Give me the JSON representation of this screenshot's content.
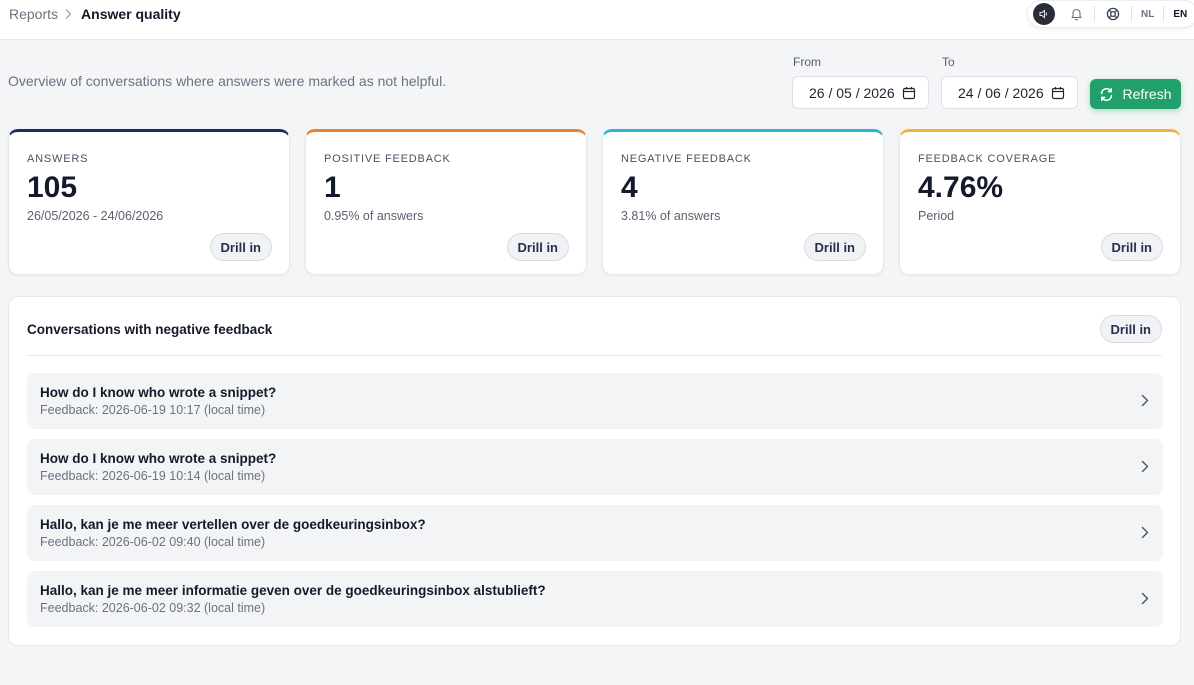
{
  "breadcrumb": {
    "root": "Reports",
    "current": "Answer quality"
  },
  "topbar": {
    "lang_nl": "NL",
    "lang_en": "EN",
    "active_lang": "EN"
  },
  "header": {
    "subtitle": "Overview of conversations where answers were marked as not helpful.",
    "from_label": "From",
    "from_value": "26 / 05 / 2026",
    "to_label": "To",
    "to_value": "24 / 06 / 2026",
    "refresh_label": "Refresh"
  },
  "cards": [
    {
      "title": "Answers",
      "value": "105",
      "sub": "26/05/2026 - 24/06/2026",
      "drill": "Drill in",
      "accent": "#1f2d5c"
    },
    {
      "title": "Positive feedback",
      "value": "1",
      "sub": "0.95% of answers",
      "drill": "Drill in",
      "accent": "#e8842f"
    },
    {
      "title": "Negative feedback",
      "value": "4",
      "sub": "3.81% of answers",
      "drill": "Drill in",
      "accent": "#2cb3d6"
    },
    {
      "title": "Feedback coverage",
      "value": "4.76%",
      "sub": "Period",
      "drill": "Drill in",
      "accent": "#f0b43c"
    }
  ],
  "negative_panel": {
    "title": "Conversations with negative feedback",
    "drill": "Drill in",
    "items": [
      {
        "question": "How do I know who wrote a snippet?",
        "meta": "Feedback: 2026-06-19 10:17 (local time)"
      },
      {
        "question": "How do I know who wrote a snippet?",
        "meta": "Feedback: 2026-06-19 10:14 (local time)"
      },
      {
        "question": "Hallo, kan je me meer vertellen over de goedkeuringsinbox?",
        "meta": "Feedback: 2026-06-02 09:40 (local time)"
      },
      {
        "question": "Hallo, kan je me meer informatie geven over de goedkeuringsinbox alstublieft?",
        "meta": "Feedback: 2026-06-02 09:32 (local time)"
      }
    ]
  },
  "colors": {
    "brand_green": "#22a06b",
    "text_primary": "#141a2b"
  },
  "icons": [
    "chevron-right-icon",
    "speaker-icon",
    "bell-icon",
    "globe-icon",
    "calendar-icon",
    "refresh-icon"
  ]
}
